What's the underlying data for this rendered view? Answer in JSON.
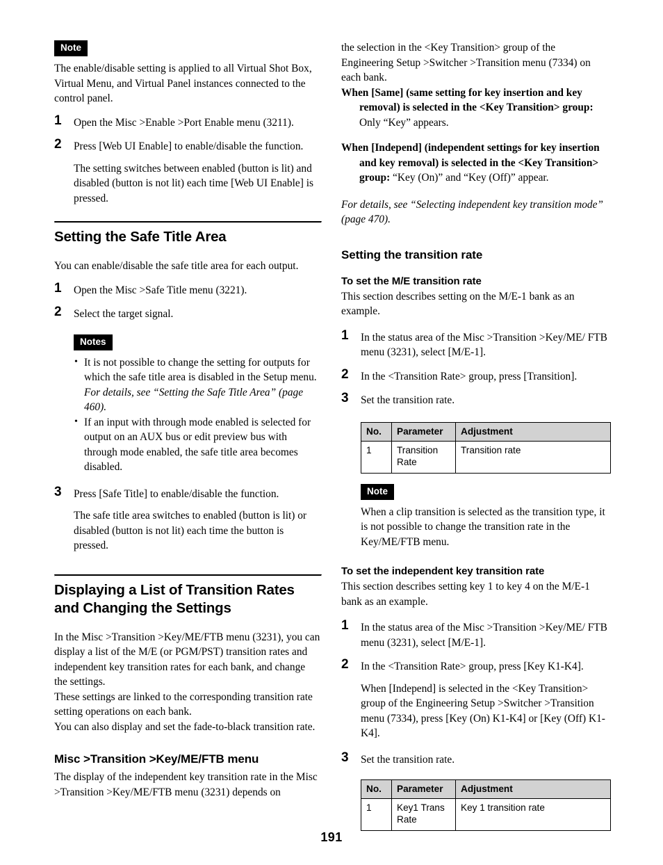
{
  "page": {
    "number": "191"
  },
  "labels": {
    "note": "Note",
    "notes": "Notes"
  },
  "left_column": {
    "note_intro": {
      "tag": "Note",
      "text": "The enable/disable setting is applied to all Virtual Shot Box, Virtual Menu, and Virtual Panel instances connected to the control panel."
    },
    "steps_web_ui": [
      {
        "num": "1",
        "text": "Open the Misc >Enable >Port Enable menu (3211)."
      },
      {
        "num": "2",
        "text": "Press [Web UI Enable] to enable/disable the function.",
        "extra": "The setting switches between enabled (button is lit) and disabled (button is not lit) each time [Web UI Enable] is pressed."
      }
    ],
    "section_safe_title": {
      "title": "Setting the Safe Title Area",
      "intro": "You can enable/disable the safe title area for each output.",
      "steps": [
        {
          "num": "1",
          "text": "Open the Misc >Safe Title menu (3221)."
        },
        {
          "num": "2",
          "text": "Select the target signal."
        },
        {
          "num": "3",
          "text": "Press [Safe Title] to enable/disable the function.",
          "extra": "The safe title area switches to enabled (button is lit) or disabled (button is not lit) each time the button is pressed."
        }
      ],
      "notes_tag": "Notes",
      "bullets": [
        {
          "text": "It is not possible to change the setting for outputs for which the safe title area is disabled in the Setup menu.",
          "italic_ref": "For details, see “Setting the Safe Title Area” (page 460)."
        },
        {
          "text": "If an input with through mode enabled is selected for output on an AUX bus or edit preview bus with through mode enabled, the safe title area becomes disabled.",
          "italic_ref": ""
        }
      ]
    },
    "section_transition_rates": {
      "title_line1": "Displaying a List of Transition Rates",
      "title_line2": "and Changing the Settings",
      "paragraphs": [
        "In the Misc >Transition >Key/ME/FTB menu (3231), you can display a list of the M/E (or PGM/PST) transition rates and independent key transition rates for each bank, and change the settings.",
        "These settings are linked to the corresponding transition rate setting operations on each bank.",
        "You can also display and set the fade-to-black transition rate."
      ],
      "subheading": "Misc >Transition >Key/ME/FTB menu",
      "sub_paragraph": "The display of the independent key transition rate in the Misc >Transition >Key/ME/FTB menu (3231) depends on"
    }
  },
  "right_column": {
    "continued_paragraph": "the selection in the <Key Transition> group of the Engineering Setup >Switcher >Transition menu (7334) on each bank.",
    "definitions": [
      {
        "bold": "When [Same] (same setting for key insertion and key removal) is selected in the <Key Transition> group:",
        "normal": " Only “Key” appears."
      },
      {
        "bold": "When [Independ] (independent settings for key insertion and key removal) is selected in the <Key Transition> group:",
        "normal": " “Key (On)” and “Key (Off)” appear."
      }
    ],
    "italic_ref": "For details, see “Selecting independent key transition mode” (page 470).",
    "section_transition_rate": {
      "title": "Setting the transition rate",
      "me_subheading": "To set the M/E transition rate",
      "me_intro": "This section describes setting on the M/E-1 bank as an example.",
      "me_steps": [
        {
          "num": "1",
          "text": "In the status area of the Misc >Transition >Key/ME/ FTB menu (3231), select [M/E-1]."
        },
        {
          "num": "2",
          "text": "In the <Transition Rate> group, press [Transition]."
        },
        {
          "num": "3",
          "text": "Set the transition rate."
        }
      ],
      "me_table": {
        "headers": [
          "No.",
          "Parameter",
          "Adjustment"
        ],
        "rows": [
          [
            "1",
            "Transition Rate",
            "Transition rate"
          ]
        ]
      },
      "me_note": {
        "tag": "Note",
        "text": "When a clip transition is selected as the transition type, it is not possible to change the transition rate in the Key/ME/FTB menu."
      },
      "key_subheading": "To set the independent key transition rate",
      "key_intro": "This section describes setting key 1 to key 4 on the M/E-1 bank as an example.",
      "key_steps": [
        {
          "num": "1",
          "text": "In the status area of the Misc >Transition >Key/ME/ FTB menu (3231), select [M/E-1]."
        },
        {
          "num": "2",
          "text": "In the <Transition Rate> group, press [Key K1-K4].",
          "extra": "When [Independ] is selected in the <Key Transition> group of the Engineering Setup >Switcher >Transition menu (7334), press [Key (On) K1-K4] or [Key (Off) K1-K4]."
        },
        {
          "num": "3",
          "text": "Set the transition rate."
        }
      ],
      "key_table": {
        "headers": [
          "No.",
          "Parameter",
          "Adjustment"
        ],
        "rows": [
          [
            "1",
            "Key1 Trans Rate",
            "Key 1 transition rate"
          ]
        ]
      }
    }
  },
  "colors": {
    "tag_background": "#000000",
    "tag_text": "#ffffff",
    "table_header_bg": "#d2d2d2",
    "rule": "#000000"
  }
}
